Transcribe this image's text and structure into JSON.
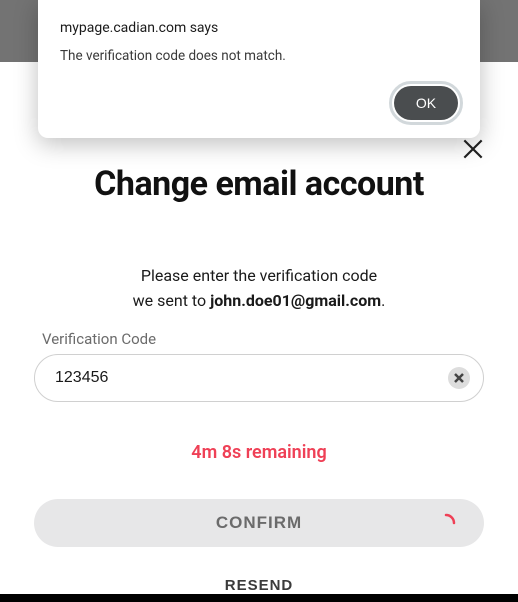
{
  "alert": {
    "originText": "mypage.cadian.com says",
    "message": "The verification code does not match.",
    "okLabel": "OK"
  },
  "modal": {
    "title": "Change email account",
    "instructionLine1": "Please enter the verification code",
    "instructionPrefix": "we sent to ",
    "email": "john.doe01@gmail.com",
    "instructionSuffix": ".",
    "field": {
      "label": "Verification Code",
      "value": "123456"
    },
    "timerText": "4m 8s remaining",
    "confirmLabel": "CONFIRM",
    "resendLabel": "RESEND"
  }
}
